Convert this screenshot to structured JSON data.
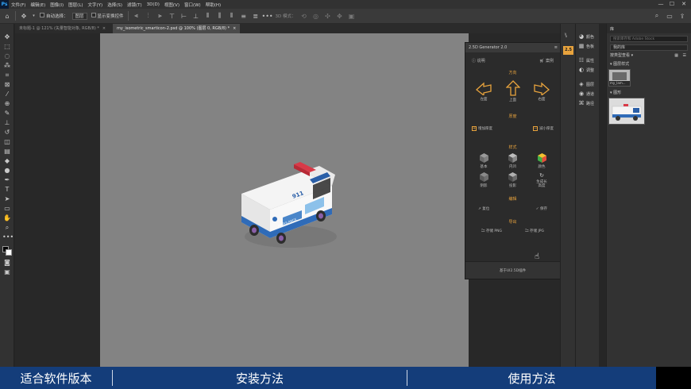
{
  "app": {
    "logo": "Ps"
  },
  "menubar": {
    "items": [
      "文件(F)",
      "编辑(E)",
      "图像(I)",
      "图层(L)",
      "文字(Y)",
      "选择(S)",
      "滤镜(T)",
      "3D(D)",
      "视图(V)",
      "窗口(W)",
      "帮助(H)"
    ],
    "min": "—",
    "max": "☐",
    "close": "✕"
  },
  "options": {
    "auto_select": "自动选择：",
    "layer_select": "图层",
    "show_transform": "显示变换控件",
    "mode_3d": "3D 模式："
  },
  "tabs": [
    {
      "label": "未标题-1 @ 121% (矢量智能对象, RGB/8) *",
      "close": "×"
    },
    {
      "label": "my_isometric_smarticon-2.psd @ 100% (图层 0, RGB/8) *",
      "close": "×"
    }
  ],
  "plugin": {
    "title": "2.5D Generator 2.0",
    "header_menu": "≡",
    "help": "说明",
    "case": "案例",
    "section_direction": "方向",
    "left": "左面",
    "top": "上面",
    "right": "右面",
    "section_thickness": "厚度",
    "add_thickness": "增加厚度",
    "reduce_thickness": "减小厚度",
    "section_style": "样式",
    "style_basic": "基本",
    "style_inner": "内凹",
    "style_color": "颜色",
    "style_shadow": "阴影",
    "style_projection": "投影",
    "style_generate": "生成长\n高度",
    "section_edit": "编辑",
    "reset": "复位",
    "save": "保存",
    "section_export": "导出",
    "export_png": "存储 PNG",
    "export_jpg": "存储 JPG",
    "footer": "基于UI2.5D插件",
    "accent": "#e8a33d"
  },
  "dock": {
    "items": [
      "颜色",
      "色板",
      "属性",
      "调整",
      "图层",
      "通道",
      "路径"
    ]
  },
  "libraries": {
    "tab": "库",
    "search_placeholder": "搜索库存和 Adobe Stock",
    "my_library": "我的库",
    "sort": "按类型查看",
    "section_styles": "图层样式",
    "style_item_label": "my_lam...",
    "section_graphics": "图形"
  },
  "ambulance": {
    "plate": "911",
    "text": "AMBULANCE"
  },
  "bottom": {
    "versions": "适合软件版本",
    "install": "安装方法",
    "usage": "使用方法"
  }
}
